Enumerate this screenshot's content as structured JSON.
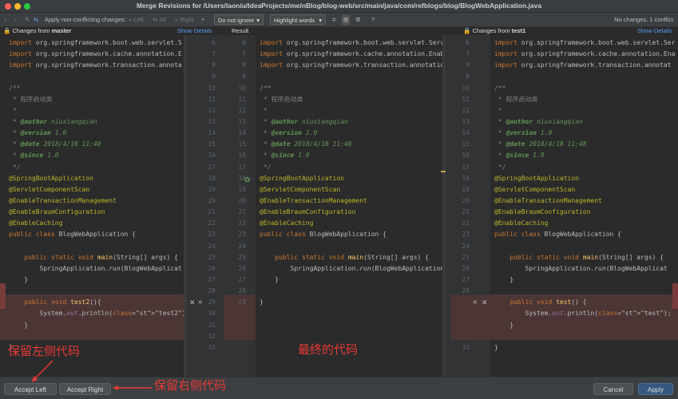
{
  "window": {
    "title": "Merge Revisions for /Users/laoniu/IdeaProjects/me/nBlog/blog-web/src/main/java/com/refblogs/blog/BlogWebApplication.java"
  },
  "toolbar": {
    "apply_nonconflicting": "Apply non-conflicting changes:",
    "left": "Left",
    "all": "All",
    "right": "Right",
    "ignore_select": "Do not ignore",
    "highlight_select": "Highlight words",
    "status": "No changes. 1 conflict."
  },
  "headers": {
    "left_prefix": "Changes from",
    "left_branch": "master",
    "left_link": "Show Details",
    "middle": "Result",
    "right_prefix": "Changes from",
    "right_branch": "test1",
    "right_link": "Show Details"
  },
  "left_lines": [
    "import org.springframework.boot.web.servlet.S",
    "import org.springframework.cache.annotation.E",
    "import org.springframework.transaction.annota",
    "",
    "/**",
    " * 程序启动类",
    " *",
    " * @author niuxiangqian",
    " * @version 1.0",
    " * @date 2018/4/18 11:48",
    " * @since 1.0",
    " */",
    "@SpringBootApplication",
    "@ServletComponentScan",
    "@EnableTransactionManagement",
    "@EnableBraumConfiguration",
    "@EnableCaching",
    "public class BlogWebApplication {",
    "",
    "    public static void main(String[] args) {",
    "        SpringApplication.run(BlogWebApplicat",
    "    }",
    "",
    "    public void test2(){",
    "        System.out.println(\"test2\");",
    "    }",
    "",
    "}"
  ],
  "middle_lines": [
    "import org.springframework.boot.web.servlet.Serv",
    "import org.springframework.cache.annotation.Enab",
    "import org.springframework.transaction.annotatio",
    "",
    "/**",
    " * 程序启动类",
    " *",
    " * @author niuxiangqian",
    " * @version 1.0",
    " * @date 2018/4/18 11:48",
    " * @since 1.0",
    " */",
    "@SpringBootApplication",
    "@ServletComponentScan",
    "@EnableTransactionManagement",
    "@EnableBraumConfiguration",
    "@EnableCaching",
    "public class BlogWebApplication {",
    "",
    "    public static void main(String[] args) {",
    "        SpringApplication.run(BlogWebApplication",
    "    }",
    "",
    "}"
  ],
  "right_lines": [
    "import org.springframework.boot.web.servlet.Ser",
    "import org.springframework.cache.annotation.Ena",
    "import org.springframework.transaction.annotat",
    "",
    "/**",
    " * 程序启动类",
    " *",
    " * @author niuxiangqian",
    " * @version 1.0",
    " * @date 2018/4/18 11:48",
    " * @since 1.0",
    " */",
    "@SpringBootApplication",
    "@ServletComponentScan",
    "@EnableTransactionManagement",
    "@EnableBraumConfiguration",
    "@EnableCaching",
    "public class BlogWebApplication {",
    "",
    "    public static void main(String[] args) {",
    "        SpringApplication.run(BlogWebApplicat",
    "    }",
    "",
    "    public void test() {",
    "        System.out.println(\"test\");",
    "    }",
    "",
    "}"
  ],
  "gutter1_nums": [
    "6",
    "7",
    "8",
    "9",
    "10",
    "11",
    "12",
    "13",
    "14",
    "15",
    "16",
    "17",
    "18",
    "19",
    "20",
    "21",
    "22",
    "23",
    "24",
    "25",
    "26",
    "27",
    "28",
    "29",
    "30",
    "31",
    "32",
    "33"
  ],
  "gutter2_nums": [
    "6",
    "7",
    "8",
    "9",
    "10",
    "11",
    "12",
    "13",
    "14",
    "15",
    "16",
    "17",
    "18",
    "19",
    "20",
    "21",
    "22",
    "23",
    "24",
    "25",
    "26",
    "27",
    "28",
    "29"
  ],
  "gutter3_nums": [
    "6",
    "7",
    "8",
    "9",
    "10",
    "11",
    "12",
    "13",
    "14",
    "15",
    "16",
    "17",
    "18",
    "19",
    "20",
    "21",
    "22",
    "23",
    "24",
    "25",
    "26",
    "27",
    "28",
    "29",
    "30",
    "31",
    "32",
    "33"
  ],
  "annotations": {
    "keep_left": "保留左侧代码",
    "final_code": "最终的代码",
    "keep_right": "保留右侧代码"
  },
  "buttons": {
    "accept_left": "Accept Left",
    "accept_right": "Accept Right",
    "cancel": "Cancel",
    "apply": "Apply"
  },
  "colors": {
    "conflict": "#4b3535",
    "accent": "#365880",
    "annotation": "#e53935"
  }
}
